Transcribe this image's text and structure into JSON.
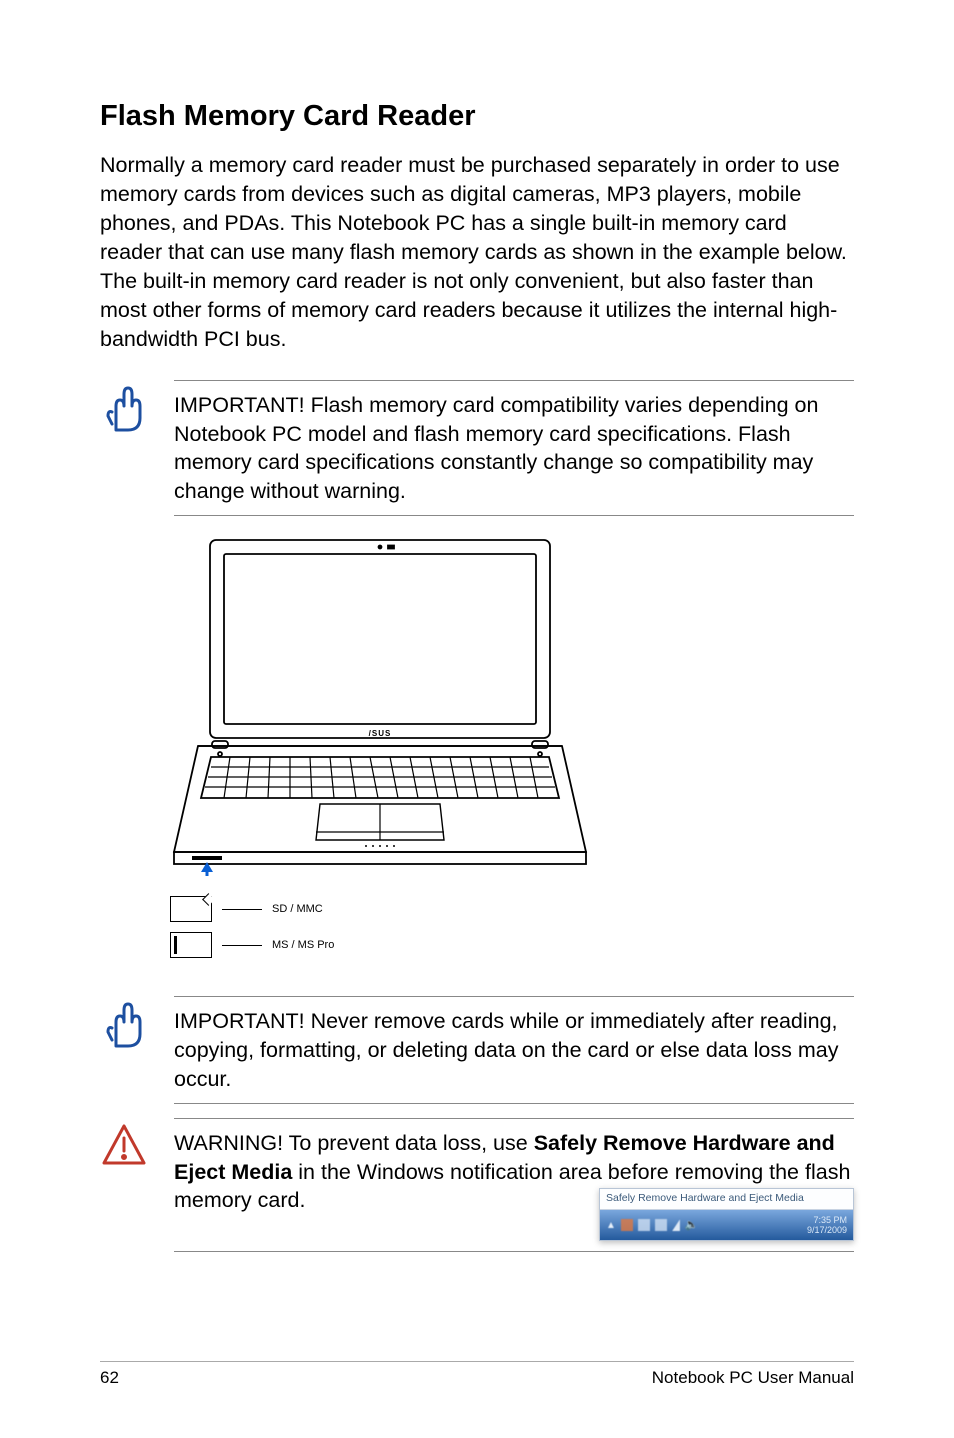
{
  "title": "Flash Memory Card Reader",
  "intro": "Normally a memory card reader must be purchased separately in order to use memory cards from devices such as digital cameras, MP3 players, mobile phones, and PDAs. This Notebook PC has a single built-in memory card reader that can use many flash memory cards as shown in the example below. The built-in memory card reader is not only convenient, but also faster than most other forms of memory card readers because it utilizes the internal high-bandwidth PCI bus.",
  "important1": "IMPORTANT! Flash memory card compatibility varies depending on Notebook PC model and flash memory card specifications. Flash memory card specifications constantly change so compatibility may change without warning.",
  "cards": {
    "sd": "SD / MMC",
    "ms": "MS / MS Pro"
  },
  "important2": "IMPORTANT!  Never remove cards while or immediately after reading, copying, formatting, or deleting data on the card or else data loss may occur.",
  "warning_prefix": "WARNING! To prevent data loss, use ",
  "warning_bold1": "Safely Remove Hardware and Eject Media",
  "warning_suffix": " in the Windows notification area before removing the flash memory card.",
  "tray_tooltip": "Safely Remove Hardware and Eject Media",
  "tray_time": "7:35 PM",
  "tray_date": "9/17/2009",
  "footer_page": "62",
  "footer_text": "Notebook PC User Manual"
}
